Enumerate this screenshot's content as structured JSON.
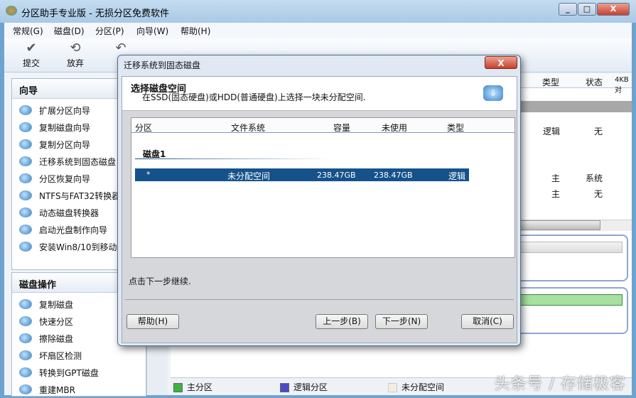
{
  "app": {
    "title": "分区助手专业版 - 无损分区免费软件"
  },
  "menu": [
    "常规(G)",
    "磁盘(D)",
    "分区(P)",
    "向导(W)",
    "帮助(H)"
  ],
  "toolbar": [
    {
      "label": "提交",
      "icon": "check-icon"
    },
    {
      "label": "放弃",
      "icon": "discard-icon"
    }
  ],
  "sidebar": {
    "wizard_title": "向导",
    "wizard_items": [
      "扩展分区向导",
      "复制磁盘向导",
      "复制分区向导",
      "迁移系统到固态磁盘",
      "分区恢复向导",
      "NTFS与FAT32转换器",
      "动态磁盘转换器",
      "启动光盘制作向导",
      "安装Win8/10到移动硬"
    ],
    "disk_ops_title": "磁盘操作",
    "disk_ops_items": [
      "复制磁盘",
      "快速分区",
      "擦除磁盘",
      "坏扇区检测",
      "转换到GPT磁盘",
      "重建MBR"
    ]
  },
  "main": {
    "columns": [
      "类型",
      "状态",
      "4KB对"
    ],
    "rows": [
      {
        "type": "逻辑",
        "status": "无"
      },
      {
        "type": "主",
        "status": "系统"
      },
      {
        "type": "主",
        "status": "无"
      }
    ],
    "disk_usage_fraction": 0.02
  },
  "legend": [
    "主分区",
    "逻辑分区",
    "未分配空间"
  ],
  "colors": {
    "primary": "#3cb43c",
    "logical": "#4a4ac8",
    "unallocated": "#f3ece0",
    "selection": "#15528c"
  },
  "dialog": {
    "title": "迁移系统到固态磁盘",
    "heading": "选择磁盘空间",
    "subheading": "在SSD(固态硬盘)或HDD(普通硬盘)上选择一块未分配空间.",
    "columns": [
      "分区",
      "文件系统",
      "容量",
      "未使用",
      "类型"
    ],
    "disk_label": "磁盘1",
    "rows": [
      {
        "partition": "*",
        "fs": "未分配空间",
        "capacity": "238.47GB",
        "unused": "238.47GB",
        "type": "逻辑"
      }
    ],
    "status": "点击下一步继续.",
    "buttons": {
      "help": "帮助(H)",
      "prev": "上一步(B)",
      "next": "下一步(N)",
      "cancel": "取消(C)"
    }
  },
  "watermark": "头条号 / 存储极客"
}
